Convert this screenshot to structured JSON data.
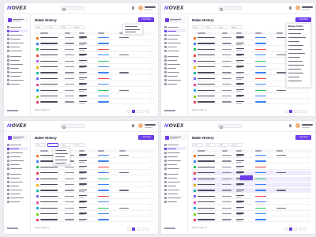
{
  "app": {
    "logo_text": "OVEX",
    "logo_mark": "M",
    "page_title": "Maker History",
    "add_button": "+ Add New",
    "pager_text": "Data per Page: 10",
    "colors": {
      "accent": "#6c3ce9",
      "background": "#ededf1",
      "surface": "#ffffff",
      "text": "#14142b",
      "link": "#3b82f6",
      "danger": "#ef4444",
      "success": "#22c55e"
    }
  },
  "toolbar": {
    "date_filter": "Date",
    "sort_filter": "Sort",
    "type_filter": "Type",
    "status_filter": "Status"
  },
  "icons": {
    "search": "search-icon",
    "notifications": "bell-icon",
    "more": "more-vertical-icon",
    "filter": "filter-icon"
  },
  "panel2_dropdown": {
    "title": "Manage Column"
  },
  "row_icon_colors": [
    "#f97316",
    "#3b82f6",
    "#22c55e",
    "#ef4444",
    "#a855f7",
    "#eab308",
    "#14b8a6",
    "#6366f1",
    "#ec4899",
    "#0ea5e9",
    "#84cc16",
    "#f43f5e"
  ],
  "row_status_colors": [
    "#3b82f6",
    "#3b82f6",
    "#ef4444",
    "#3b82f6",
    "#22c55e",
    "#3b82f6",
    "#3b82f6",
    "#ef4444",
    "#3b82f6",
    "#22c55e",
    "#3b82f6",
    "#3b82f6"
  ]
}
